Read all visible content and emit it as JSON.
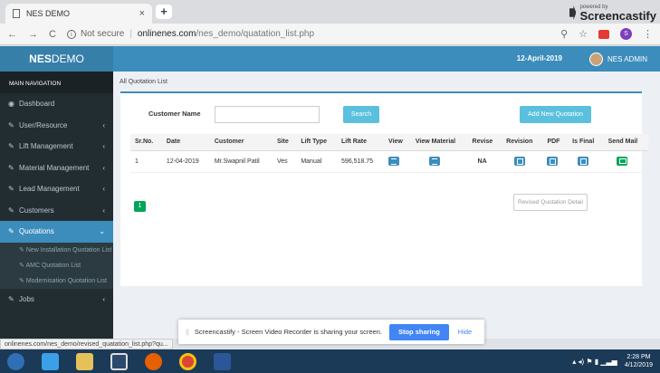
{
  "browser": {
    "tab_title": "NES DEMO",
    "new_tab": "+",
    "close_glyph": "×",
    "back_glyph": "←",
    "forward_glyph": "→",
    "reload_glyph": "C",
    "info_glyph": "i",
    "security": "Not secure",
    "url_host": "onlinenes.com",
    "url_path": "/nes_demo/quatation_list.php",
    "zoom_glyph": "⚲",
    "star_glyph": "☆",
    "profile_letter": "S",
    "menu_glyph": "⋮",
    "screencastify_small": "powered by",
    "screencastify_big": "Screencastify"
  },
  "header": {
    "brand_bold": "NES",
    "brand_rest": "DEMO",
    "date": "12-April-2019",
    "user": "NES ADMIN"
  },
  "sidebar": {
    "heading": "MAIN NAVIGATION",
    "items": [
      {
        "label": "Dashboard",
        "icon": "dashboard-icon",
        "glyph": "◉",
        "arrow": ""
      },
      {
        "label": "User/Resource",
        "icon": "edit-icon",
        "glyph": "✎",
        "arrow": "‹"
      },
      {
        "label": "Lift Management",
        "icon": "edit-icon",
        "glyph": "✎",
        "arrow": "‹"
      },
      {
        "label": "Material Management",
        "icon": "edit-icon",
        "glyph": "✎",
        "arrow": "‹"
      },
      {
        "label": "Lead Management",
        "icon": "edit-icon",
        "glyph": "✎",
        "arrow": "‹"
      },
      {
        "label": "Customers",
        "icon": "edit-icon",
        "glyph": "✎",
        "arrow": "‹"
      },
      {
        "label": "Quotations",
        "icon": "edit-icon",
        "glyph": "✎",
        "arrow": "⌄"
      }
    ],
    "subitems": [
      {
        "label": "New Installation Quotation List"
      },
      {
        "label": "AMC Quotation List"
      },
      {
        "label": "Modernisation Quotation List"
      }
    ],
    "jobs": {
      "label": "Jobs",
      "glyph": "✎",
      "arrow": "‹"
    }
  },
  "content": {
    "title": "All Quotation List",
    "customer_label": "Customer Name",
    "customer_value": "",
    "search_label": "Search",
    "add_label": "Add New Quotation",
    "columns": [
      "Sr.No.",
      "Date",
      "Customer",
      "Site",
      "Lift Type",
      "Lift Rate",
      "View",
      "View Material",
      "Revise",
      "Revision",
      "PDF",
      "Is Final",
      "Send Mail"
    ],
    "rows": [
      {
        "srno": "1",
        "date": "12-04-2019",
        "customer": "Mr.Swapnil Patil",
        "site": "Ves",
        "lift_type": "Manual",
        "lift_rate": "596,518.75",
        "revise": "NA"
      }
    ],
    "tooltip": "Revised Quotation Detail",
    "page": "1"
  },
  "share_bar": {
    "grip": "||",
    "message": "Screencastify - Screen Video Recorder is sharing your screen.",
    "stop_label": "Stop sharing",
    "hide_label": "Hide"
  },
  "status_url": "onlinenes.com/nes_demo/revised_quatation_list.php?qu...",
  "taskbar": {
    "tray_glyphs": "▴  ◂)  ⚑  ▮  ▁▃▅",
    "time": "2:28 PM",
    "date": "4/12/2019"
  },
  "colors": {
    "header": "#3c8dbc",
    "sidebar": "#222d32",
    "button": "#5bc0de",
    "success": "#00a65a"
  }
}
